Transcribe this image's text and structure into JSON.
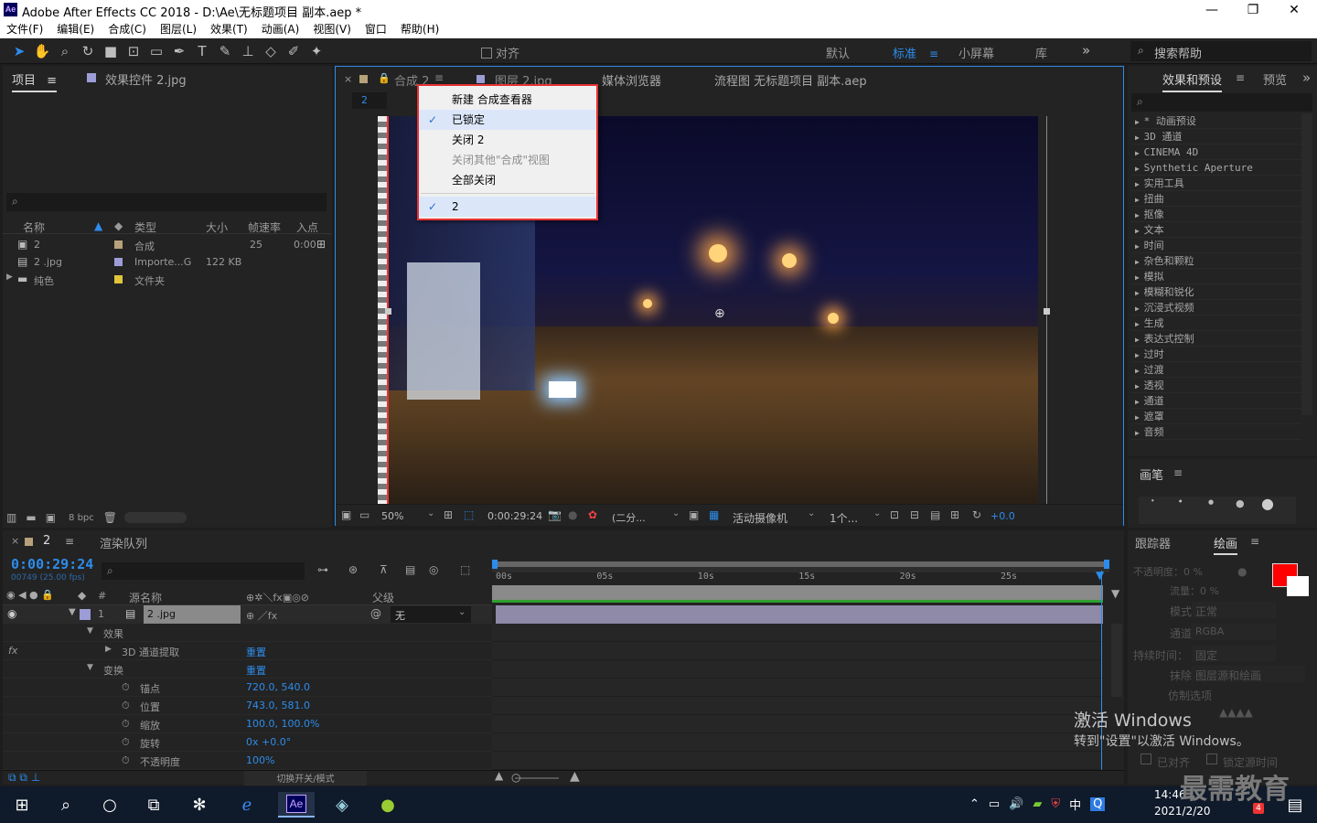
{
  "window": {
    "title": "Adobe After Effects CC 2018 - D:\\Ae\\无标题项目 副本.aep *",
    "app_icon": "Ae",
    "minimize": "—",
    "maximize": "❐",
    "close": "✕"
  },
  "menu": [
    "文件(F)",
    "编辑(E)",
    "合成(C)",
    "图层(L)",
    "效果(T)",
    "动画(A)",
    "视图(V)",
    "窗口",
    "帮助(H)"
  ],
  "toolbar": {
    "align_label": "对齐",
    "workspaces": [
      "默认",
      "标准",
      "小屏幕",
      "库"
    ],
    "active_workspace": "标准",
    "search_help": "搜索帮助"
  },
  "project_panel": {
    "tab_project": "项目",
    "tab_effect_controls": "效果控件 2.jpg",
    "columns": [
      "名称",
      "类型",
      "大小",
      "帧速率",
      "入点"
    ],
    "rows": [
      {
        "name": "2",
        "type": "合成",
        "size": "",
        "fps": "25",
        "in": "0:00",
        "color": "#b6a17a"
      },
      {
        "name": "2 .jpg",
        "type": "Importe...G",
        "size": "122 KB",
        "fps": "",
        "in": "",
        "color": "#9c9cd6"
      },
      {
        "name": "纯色",
        "type": "文件夹",
        "size": "",
        "fps": "",
        "in": "",
        "color": "#e0c53a"
      }
    ],
    "bpc": "8 bpc"
  },
  "comp_panel": {
    "tabs": [
      "合成 2",
      "图层 2.jpg",
      "媒体浏览器",
      "流程图 无标题项目 副本.aep"
    ],
    "subtab": "2",
    "footer": {
      "zoom": "50%",
      "time": "0:00:29:24",
      "resolution": "(二分...",
      "camera": "活动摄像机",
      "views": "1个...",
      "exposure": "+0.0"
    }
  },
  "context_menu": {
    "items": [
      {
        "label": "新建 合成查看器",
        "checked": false,
        "disabled": false
      },
      {
        "label": "已锁定",
        "checked": true,
        "disabled": false
      },
      {
        "label": "关闭 2",
        "checked": false,
        "disabled": false
      },
      {
        "label": "关闭其他\"合成\"视图",
        "checked": false,
        "disabled": true
      },
      {
        "label": "全部关闭",
        "checked": false,
        "disabled": false
      },
      {
        "label": "2",
        "checked": true,
        "disabled": false
      }
    ]
  },
  "effects_panel": {
    "tab": "效果和预设",
    "tab2": "预览",
    "items": [
      "* 动画预设",
      "3D 通道",
      "CINEMA 4D",
      "Synthetic Aperture",
      "实用工具",
      "扭曲",
      "抠像",
      "文本",
      "时间",
      "杂色和颗粒",
      "模拟",
      "模糊和锐化",
      "沉浸式视频",
      "生成",
      "表达式控制",
      "过时",
      "过渡",
      "透视",
      "通道",
      "遮罩",
      "音频"
    ]
  },
  "brush_panel": {
    "tab": "画笔",
    "sizes": [
      "1",
      "3",
      "5",
      "9",
      "13"
    ]
  },
  "paint_panel": {
    "tab_tracker": "跟踪器",
    "tab_paint": "绘画",
    "opacity": "不透明度：0 %",
    "flow": "流量：0 %",
    "mode_label": "模式：",
    "mode": "正常",
    "channel_label": "通道：",
    "channel": "RGBA",
    "duration_label": "持续时间：",
    "duration": "固定",
    "erase_label": "抹除：",
    "erase": "图层源和绘画",
    "clone_label": "仿制选项",
    "aligned": "已对齐",
    "lock_source": "锁定源时间",
    "fg_color": "#ff0000",
    "bg_color": "#ffffff"
  },
  "watermark": {
    "line1": "激活 Windows",
    "line2": "转到\"设置\"以激活 Windows。"
  },
  "timeline": {
    "comp_tab": "2",
    "render_queue": "渲染队列",
    "timecode": "0:00:29:24",
    "frames": "00749 (25.00 fps)",
    "col_source": "源名称",
    "col_parent": "父级",
    "layer_num": "1",
    "layer_name": "2 .jpg",
    "parent_value": "无",
    "ruler": [
      "00s",
      "05s",
      "10s",
      "15s",
      "20s",
      "25s"
    ],
    "props": [
      {
        "name": "效果",
        "value": ""
      },
      {
        "name": "3D 通道提取",
        "value": "重置"
      },
      {
        "name": "变换",
        "value": "重置"
      },
      {
        "name": "锚点",
        "value": "720.0, 540.0"
      },
      {
        "name": "位置",
        "value": "743.0, 581.0"
      },
      {
        "name": "缩放",
        "value": "100.0, 100.0%"
      },
      {
        "name": "旋转",
        "value": "0x +0.0°"
      },
      {
        "name": "不透明度",
        "value": "100%"
      }
    ],
    "switch_mode": "切换开关/模式"
  },
  "taskbar": {
    "time": "14:46",
    "date": "2021/2/20",
    "ime": "中",
    "brand": "最需教育",
    "badge": "4"
  }
}
